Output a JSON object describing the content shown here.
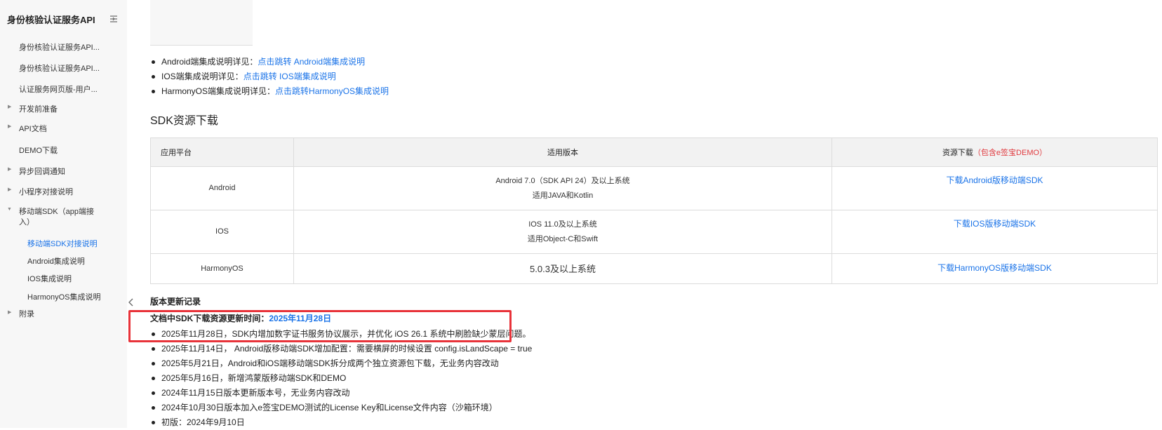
{
  "sidebar": {
    "title": "身份核验认证服务API",
    "items": [
      {
        "label": "身份核验认证服务API..."
      },
      {
        "label": "身份核验认证服务API..."
      },
      {
        "label": "认证服务网页版-用户..."
      },
      {
        "label": "开发前准备"
      },
      {
        "label": "API文档"
      },
      {
        "label": "DEMO下载"
      },
      {
        "label": "异步回调通知"
      },
      {
        "label": "小程序对接说明"
      },
      {
        "label": "移动端SDK（app端接"
      },
      {
        "label": "入）"
      },
      {
        "label": "移动端SDK对接说明"
      },
      {
        "label": "Android集成说明"
      },
      {
        "label": "IOS集成说明"
      },
      {
        "label": "HarmonyOS集成说明"
      },
      {
        "label": "附录"
      }
    ]
  },
  "integration": [
    {
      "prefix": "Android端集成说明详见：",
      "link": "点击跳转 Android端集成说明"
    },
    {
      "prefix": "IOS端集成说明详见：",
      "link": "点击跳转 IOS端集成说明"
    },
    {
      "prefix": "HarmonyOS端集成说明详见：",
      "link": "点击跳转HarmonyOS集成说明"
    }
  ],
  "sdk_section": {
    "title": "SDK资源下载",
    "headers": {
      "platform": "应用平台",
      "version": "适用版本",
      "download": "资源下载",
      "download_note": "（包含e签宝DEMO）"
    },
    "rows": [
      {
        "platform": "Android",
        "v1": "Android 7.0（SDK API 24）及以上系统",
        "v2": "适用JAVA和Kotlin",
        "link": "下载Android版移动端SDK"
      },
      {
        "platform": "IOS",
        "v1": "IOS 11.0及以上系统",
        "v2": "适用Object-C和Swift",
        "link": "下载IOS版移动端SDK"
      },
      {
        "platform": "HarmonyOS",
        "v1": "5.0.3及以上系统",
        "link": "下载HarmonyOS版移动端SDK"
      }
    ]
  },
  "changelog": {
    "title": "版本更新记录",
    "update_label": "文档中SDK下载资源更新时间：",
    "update_date": "2025年11月28日",
    "entries": [
      "2025年11月28日，SDK内增加数字证书服务协议展示，并优化 iOS 26.1 系统中刷脸缺少蒙层问题。",
      "2025年11月14日，  Android版移动端SDK增加配置：需要横屏的时候设置 config.isLandScape = true",
      "2025年5月21日，Android和iOS端移动端SDK拆分成两个独立资源包下载，无业务内容改动",
      "2025年5月16日，新增鸿蒙版移动端SDK和DEMO",
      "2024年11月15日版本更新版本号，无业务内容改动",
      "2024年10月30日版本加入e签宝DEMO测试的License Key和License文件内容（沙箱环境）",
      "初版：2024年9月10日"
    ]
  },
  "colors": {
    "link": "#1a73e8",
    "highlight": "#e8333a",
    "sidebar_bg": "#f7f7f7"
  }
}
